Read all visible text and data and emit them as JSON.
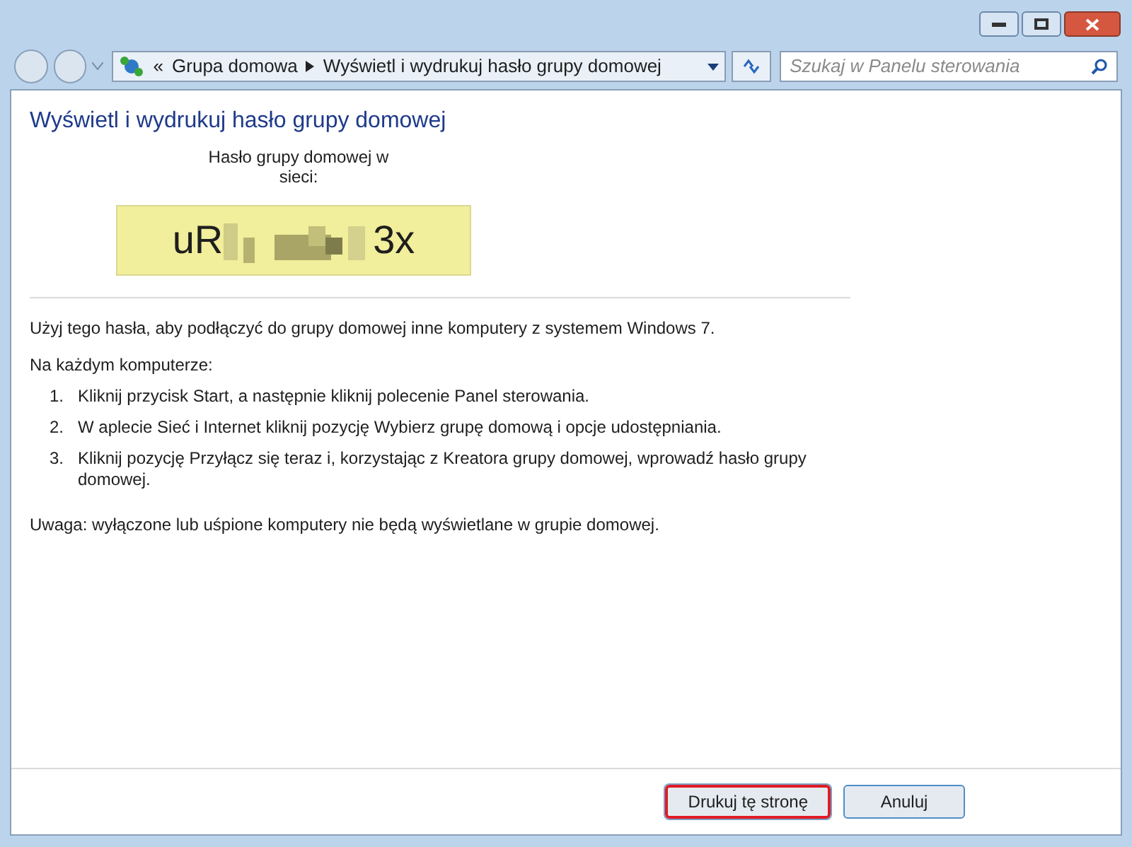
{
  "address_bar": {
    "path_prefix": "«",
    "breadcrumbs": [
      "Grupa domowa",
      "Wyświetl i wydrukuj hasło grupy domowej"
    ]
  },
  "search": {
    "placeholder": "Szukaj w Panelu sterowania"
  },
  "page": {
    "title": "Wyświetl i wydrukuj hasło grupy domowej",
    "password_label": "Hasło grupy domowej w sieci:",
    "password": {
      "start": "uR",
      "end": "3x",
      "obscured": true
    },
    "intro": "Użyj tego hasła, aby podłączyć do grupy domowej inne komputery z systemem Windows 7.",
    "steps_heading": "Na każdym komputerze:",
    "steps": [
      {
        "number": "1.",
        "text": "Kliknij przycisk Start, a następnie kliknij polecenie Panel sterowania."
      },
      {
        "number": "2.",
        "text": "W aplecie Sieć i Internet kliknij pozycję Wybierz grupę domową i opcje udostępniania."
      },
      {
        "number": "3.",
        "text": "Kliknij pozycję Przyłącz się teraz i, korzystając z Kreatora grupy domowej, wprowadź hasło grupy domowej."
      }
    ],
    "note": "Uwaga: wyłączone lub uśpione komputery nie będą wyświetlane w grupie domowej."
  },
  "buttons": [
    {
      "label": "Drukuj tę stronę",
      "highlighted": true
    },
    {
      "label": "Anuluj",
      "highlighted": false
    }
  ]
}
